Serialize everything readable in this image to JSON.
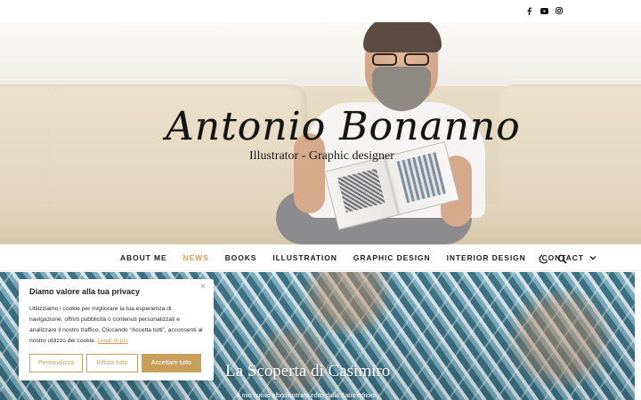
{
  "social": {
    "icons": [
      "facebook-icon",
      "youtube-icon",
      "instagram-icon"
    ]
  },
  "hero": {
    "title": "Antonio Bonanno",
    "tagline": "Illustrator - Graphic designer"
  },
  "nav": {
    "items": [
      {
        "label": "ABOUT ME",
        "active": false
      },
      {
        "label": "NEWS",
        "active": true
      },
      {
        "label": "BOOKS",
        "active": false
      },
      {
        "label": "ILLUSTRATION",
        "active": false
      },
      {
        "label": "GRAPHIC DESIGN",
        "active": false
      },
      {
        "label": "INTERIOR DESIGN",
        "active": false
      },
      {
        "label": "CONTACT",
        "active": false,
        "has_dropdown": true
      }
    ],
    "icons": [
      "dark-mode-moon-icon",
      "search-icon"
    ],
    "active_color": "#c9a55c"
  },
  "feature": {
    "title": "La Scoperta di Casimiro",
    "subtitle": "Il mio nuovo albo illustrato edito dalla Sabir editore"
  },
  "cookie": {
    "title": "Diamo valore alla tua privacy",
    "body": "Utilizziamo i cookie per migliorare la tua esperienza di navigazione, offrirti pubblicità o contenuti personalizzati e analizzare il nostro traffico. Cliccando “Accetta tutti”, acconsenti al nostro utilizzo dei cookie.",
    "more_link": "Leggi di più",
    "btn_customize": "Personalizza",
    "btn_reject": "Rifiuta tutto",
    "btn_accept": "Accettare tutto",
    "close_symbol": "×",
    "accent_color": "#c8a05a"
  }
}
